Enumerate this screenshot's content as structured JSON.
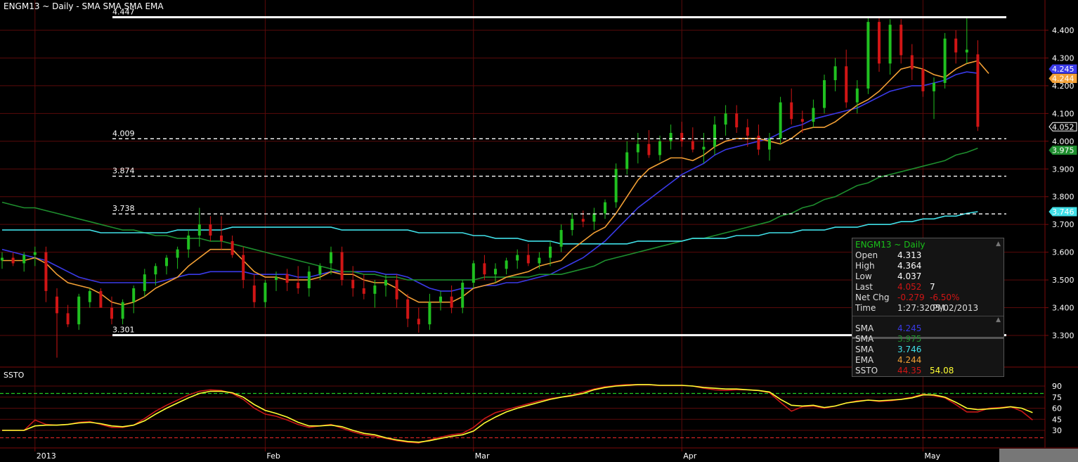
{
  "header": {
    "title": "ENGM13 ~ Daily  -  SMA SMA SMA EMA"
  },
  "colors": {
    "up": "#20c020",
    "down": "#d01515",
    "sma_blue": "#3a3ae8",
    "sma_green": "#1e8e2e",
    "sma_cyan": "#40e0e8",
    "ema_orange": "#f3a035",
    "ssto_k": "#ffff33",
    "ssto_d": "#c81818",
    "grid": "#5a0a0a",
    "axis": "#7a0a0a",
    "level": "#ffffff"
  },
  "levels": [
    {
      "value": 4.447,
      "label": "4.447",
      "style": "solid"
    },
    {
      "value": 4.009,
      "label": "4.009",
      "style": "dashed"
    },
    {
      "value": 3.874,
      "label": "3.874",
      "style": "dashed"
    },
    {
      "value": 3.738,
      "label": "3.738",
      "style": "dashed"
    },
    {
      "value": 3.301,
      "label": "3.301",
      "style": "solid"
    }
  ],
  "price_axis": {
    "ticks": [
      "4.400",
      "4.300",
      "4.200",
      "4.100",
      "4.000",
      "3.900",
      "3.800",
      "3.700",
      "3.600",
      "3.500",
      "3.400",
      "3.300"
    ],
    "tick_values": [
      4.4,
      4.3,
      4.2,
      4.1,
      4.0,
      3.9,
      3.8,
      3.7,
      3.6,
      3.5,
      3.4,
      3.3
    ],
    "ylim": [
      3.2,
      4.5
    ],
    "markers": [
      {
        "label": "4.245",
        "value": 4.245,
        "color": "#3a3ae8"
      },
      {
        "label": "4.244",
        "value": 4.244,
        "color": "#f3a035"
      },
      {
        "label": "4.052",
        "value": 4.052,
        "color": "#000000"
      },
      {
        "label": "3.975",
        "value": 3.975,
        "color": "#1e8e2e"
      },
      {
        "label": "3.746",
        "value": 3.746,
        "color": "#40e0e8"
      }
    ]
  },
  "ssto_panel": {
    "label": "SSTO",
    "ticks": [
      "90",
      "75",
      "60",
      "45",
      "30"
    ],
    "tick_values": [
      90,
      75,
      60,
      45,
      30
    ],
    "upper": 80,
    "lower": 20,
    "ylim": [
      15,
      95
    ]
  },
  "x_axis": {
    "labels": [
      {
        "text": "2013",
        "index": 3
      },
      {
        "text": "Feb",
        "index": 24
      },
      {
        "text": "Mar",
        "index": 43
      },
      {
        "text": "Apr",
        "index": 62
      },
      {
        "text": "May",
        "index": 84
      }
    ]
  },
  "info_box": {
    "title": "ENGM13 ~ Daily",
    "rows": [
      {
        "label": "Open",
        "value": "4.313",
        "color": "#ffffff"
      },
      {
        "label": "High",
        "value": "4.364",
        "color": "#ffffff"
      },
      {
        "label": "Low",
        "value": "4.037",
        "color": "#ffffff"
      },
      {
        "label": "Last",
        "value": "4.052",
        "color": "#d01515",
        "extra": "7",
        "extra_color": "#ffffff"
      },
      {
        "label": "Net Chg",
        "value": "-0.279",
        "color": "#d01515",
        "extra": "-6.50%",
        "extra_color": "#d01515"
      },
      {
        "label": "Time",
        "value": "1:27:32 PM",
        "color": "#dddddd",
        "extra": "05/02/2013",
        "extra_color": "#dddddd"
      }
    ],
    "studies": [
      {
        "label": "SMA",
        "value": "4.245",
        "color": "#3a3ae8"
      },
      {
        "label": "SMA",
        "value": "3.975",
        "color": "#1e8e2e"
      },
      {
        "label": "SMA",
        "value": "3.746",
        "color": "#40e0e8"
      },
      {
        "label": "EMA",
        "value": "4.244",
        "color": "#f3a035"
      },
      {
        "label": "SSTO",
        "value": "44.35",
        "color": "#d01515",
        "extra": "54.08",
        "extra_color": "#ffff33"
      }
    ]
  },
  "chart_data": {
    "type": "candlestick",
    "title": "ENGM13 ~ Daily",
    "candles": [
      [
        3.57,
        3.6,
        3.54,
        3.58
      ],
      [
        3.58,
        3.6,
        3.55,
        3.56
      ],
      [
        3.56,
        3.6,
        3.53,
        3.59
      ],
      [
        3.59,
        3.62,
        3.55,
        3.6
      ],
      [
        3.6,
        3.62,
        3.42,
        3.46
      ],
      [
        3.44,
        3.47,
        3.22,
        3.38
      ],
      [
        3.38,
        3.41,
        3.33,
        3.34
      ],
      [
        3.34,
        3.45,
        3.32,
        3.44
      ],
      [
        3.42,
        3.47,
        3.4,
        3.46
      ],
      [
        3.46,
        3.47,
        3.4,
        3.4
      ],
      [
        3.4,
        3.44,
        3.34,
        3.36
      ],
      [
        3.36,
        3.43,
        3.34,
        3.42
      ],
      [
        3.42,
        3.48,
        3.38,
        3.47
      ],
      [
        3.46,
        3.54,
        3.44,
        3.52
      ],
      [
        3.52,
        3.56,
        3.48,
        3.55
      ],
      [
        3.55,
        3.59,
        3.52,
        3.58
      ],
      [
        3.58,
        3.62,
        3.54,
        3.61
      ],
      [
        3.61,
        3.68,
        3.58,
        3.66
      ],
      [
        3.66,
        3.76,
        3.62,
        3.7
      ],
      [
        3.7,
        3.73,
        3.64,
        3.66
      ],
      [
        3.66,
        3.73,
        3.61,
        3.64
      ],
      [
        3.64,
        3.66,
        3.58,
        3.59
      ],
      [
        3.59,
        3.62,
        3.47,
        3.5
      ],
      [
        3.48,
        3.52,
        3.4,
        3.42
      ],
      [
        3.42,
        3.5,
        3.4,
        3.49
      ],
      [
        3.5,
        3.53,
        3.46,
        3.51
      ],
      [
        3.52,
        3.54,
        3.46,
        3.49
      ],
      [
        3.49,
        3.55,
        3.45,
        3.47
      ],
      [
        3.47,
        3.55,
        3.44,
        3.53
      ],
      [
        3.52,
        3.56,
        3.5,
        3.55
      ],
      [
        3.56,
        3.62,
        3.52,
        3.6
      ],
      [
        3.6,
        3.62,
        3.48,
        3.5
      ],
      [
        3.5,
        3.55,
        3.44,
        3.47
      ],
      [
        3.47,
        3.52,
        3.43,
        3.45
      ],
      [
        3.45,
        3.5,
        3.4,
        3.48
      ],
      [
        3.48,
        3.52,
        3.44,
        3.5
      ],
      [
        3.5,
        3.52,
        3.4,
        3.43
      ],
      [
        3.43,
        3.45,
        3.33,
        3.36
      ],
      [
        3.36,
        3.4,
        3.31,
        3.34
      ],
      [
        3.34,
        3.45,
        3.32,
        3.42
      ],
      [
        3.42,
        3.46,
        3.39,
        3.44
      ],
      [
        3.44,
        3.48,
        3.38,
        3.4
      ],
      [
        3.4,
        3.5,
        3.38,
        3.49
      ],
      [
        3.49,
        3.57,
        3.47,
        3.56
      ],
      [
        3.56,
        3.59,
        3.5,
        3.52
      ],
      [
        3.52,
        3.56,
        3.49,
        3.54
      ],
      [
        3.54,
        3.58,
        3.52,
        3.57
      ],
      [
        3.57,
        3.61,
        3.54,
        3.59
      ],
      [
        3.59,
        3.63,
        3.55,
        3.56
      ],
      [
        3.56,
        3.6,
        3.54,
        3.58
      ],
      [
        3.58,
        3.64,
        3.55,
        3.62
      ],
      [
        3.62,
        3.7,
        3.6,
        3.68
      ],
      [
        3.68,
        3.74,
        3.66,
        3.72
      ],
      [
        3.72,
        3.75,
        3.69,
        3.71
      ],
      [
        3.71,
        3.76,
        3.68,
        3.74
      ],
      [
        3.74,
        3.79,
        3.72,
        3.78
      ],
      [
        3.78,
        3.92,
        3.76,
        3.9
      ],
      [
        3.9,
        4.0,
        3.88,
        3.96
      ],
      [
        3.96,
        4.03,
        3.92,
        3.99
      ],
      [
        3.99,
        4.04,
        3.94,
        3.95
      ],
      [
        3.95,
        4.02,
        3.93,
        4.0
      ],
      [
        4.0,
        4.06,
        3.97,
        4.03
      ],
      [
        4.03,
        4.07,
        3.98,
        4.0
      ],
      [
        4.0,
        4.05,
        3.96,
        3.97
      ],
      [
        3.97,
        4.03,
        3.92,
        3.98
      ],
      [
        3.98,
        4.09,
        3.95,
        4.06
      ],
      [
        4.06,
        4.13,
        4.02,
        4.1
      ],
      [
        4.1,
        4.13,
        4.03,
        4.05
      ],
      [
        4.05,
        4.08,
        3.98,
        4.02
      ],
      [
        4.02,
        4.06,
        3.95,
        3.97
      ],
      [
        3.97,
        4.03,
        3.93,
        4.01
      ],
      [
        4.01,
        4.16,
        3.99,
        4.14
      ],
      [
        4.14,
        4.19,
        4.06,
        4.08
      ],
      [
        4.08,
        4.11,
        4.03,
        4.07
      ],
      [
        4.07,
        4.15,
        4.05,
        4.12
      ],
      [
        4.12,
        4.24,
        4.1,
        4.22
      ],
      [
        4.22,
        4.3,
        4.18,
        4.27
      ],
      [
        4.27,
        4.33,
        4.12,
        4.14
      ],
      [
        4.14,
        4.22,
        4.1,
        4.19
      ],
      [
        4.19,
        4.45,
        4.17,
        4.43
      ],
      [
        4.43,
        4.45,
        4.25,
        4.28
      ],
      [
        4.28,
        4.44,
        4.24,
        4.42
      ],
      [
        4.42,
        4.44,
        4.28,
        4.31
      ],
      [
        4.31,
        4.35,
        4.22,
        4.26
      ],
      [
        4.26,
        4.3,
        4.16,
        4.18
      ],
      [
        4.18,
        4.23,
        4.08,
        4.21
      ],
      [
        4.21,
        4.39,
        4.19,
        4.37
      ],
      [
        4.37,
        4.4,
        4.28,
        4.32
      ],
      [
        4.32,
        4.45,
        4.28,
        4.33
      ],
      [
        4.313,
        4.364,
        4.037,
        4.052
      ]
    ],
    "series": [
      {
        "name": "SMA",
        "color": "#3a3ae8",
        "values": [
          3.61,
          3.6,
          3.59,
          3.58,
          3.57,
          3.55,
          3.53,
          3.51,
          3.5,
          3.49,
          3.49,
          3.49,
          3.49,
          3.49,
          3.49,
          3.5,
          3.51,
          3.52,
          3.52,
          3.53,
          3.53,
          3.53,
          3.53,
          3.52,
          3.52,
          3.52,
          3.52,
          3.51,
          3.51,
          3.52,
          3.53,
          3.53,
          3.53,
          3.53,
          3.53,
          3.52,
          3.52,
          3.51,
          3.49,
          3.47,
          3.46,
          3.46,
          3.47,
          3.47,
          3.48,
          3.48,
          3.49,
          3.49,
          3.5,
          3.51,
          3.52,
          3.54,
          3.56,
          3.58,
          3.61,
          3.64,
          3.68,
          3.72,
          3.76,
          3.79,
          3.82,
          3.85,
          3.88,
          3.9,
          3.92,
          3.95,
          3.97,
          3.98,
          3.99,
          4.0,
          4.01,
          4.03,
          4.05,
          4.06,
          4.08,
          4.09,
          4.1,
          4.11,
          4.12,
          4.14,
          4.16,
          4.18,
          4.19,
          4.2,
          4.2,
          4.21,
          4.22,
          4.24,
          4.25,
          4.245
        ]
      },
      {
        "name": "SMA",
        "color": "#1e8e2e",
        "values": [
          3.78,
          3.77,
          3.76,
          3.76,
          3.75,
          3.74,
          3.73,
          3.72,
          3.71,
          3.7,
          3.69,
          3.68,
          3.68,
          3.67,
          3.66,
          3.66,
          3.65,
          3.65,
          3.65,
          3.64,
          3.64,
          3.63,
          3.62,
          3.61,
          3.6,
          3.59,
          3.58,
          3.57,
          3.56,
          3.55,
          3.54,
          3.53,
          3.53,
          3.52,
          3.52,
          3.51,
          3.51,
          3.5,
          3.5,
          3.5,
          3.5,
          3.5,
          3.5,
          3.5,
          3.51,
          3.51,
          3.51,
          3.51,
          3.51,
          3.52,
          3.52,
          3.52,
          3.53,
          3.54,
          3.55,
          3.57,
          3.58,
          3.59,
          3.6,
          3.61,
          3.62,
          3.63,
          3.64,
          3.65,
          3.65,
          3.66,
          3.67,
          3.68,
          3.69,
          3.7,
          3.71,
          3.73,
          3.74,
          3.76,
          3.77,
          3.79,
          3.8,
          3.82,
          3.84,
          3.85,
          3.87,
          3.88,
          3.89,
          3.9,
          3.91,
          3.92,
          3.93,
          3.95,
          3.96,
          3.975
        ]
      },
      {
        "name": "SMA",
        "color": "#40e0e8",
        "values": [
          3.68,
          3.68,
          3.68,
          3.68,
          3.68,
          3.68,
          3.68,
          3.68,
          3.68,
          3.67,
          3.67,
          3.67,
          3.67,
          3.67,
          3.67,
          3.67,
          3.68,
          3.68,
          3.68,
          3.68,
          3.68,
          3.69,
          3.69,
          3.69,
          3.69,
          3.69,
          3.69,
          3.69,
          3.69,
          3.69,
          3.69,
          3.68,
          3.68,
          3.68,
          3.68,
          3.68,
          3.68,
          3.68,
          3.67,
          3.67,
          3.67,
          3.67,
          3.67,
          3.66,
          3.66,
          3.65,
          3.65,
          3.65,
          3.64,
          3.64,
          3.64,
          3.63,
          3.63,
          3.63,
          3.63,
          3.63,
          3.63,
          3.63,
          3.64,
          3.64,
          3.64,
          3.64,
          3.64,
          3.65,
          3.65,
          3.65,
          3.65,
          3.66,
          3.66,
          3.66,
          3.67,
          3.67,
          3.67,
          3.68,
          3.68,
          3.68,
          3.69,
          3.69,
          3.69,
          3.7,
          3.7,
          3.7,
          3.71,
          3.71,
          3.72,
          3.72,
          3.73,
          3.73,
          3.74,
          3.746
        ]
      },
      {
        "name": "EMA",
        "color": "#f3a035",
        "values": [
          3.57,
          3.57,
          3.57,
          3.58,
          3.56,
          3.52,
          3.49,
          3.48,
          3.47,
          3.45,
          3.42,
          3.41,
          3.42,
          3.44,
          3.47,
          3.49,
          3.51,
          3.55,
          3.58,
          3.61,
          3.61,
          3.61,
          3.57,
          3.53,
          3.51,
          3.51,
          3.5,
          3.5,
          3.5,
          3.51,
          3.53,
          3.52,
          3.52,
          3.5,
          3.49,
          3.49,
          3.47,
          3.44,
          3.42,
          3.42,
          3.42,
          3.42,
          3.44,
          3.47,
          3.48,
          3.49,
          3.51,
          3.52,
          3.53,
          3.55,
          3.56,
          3.57,
          3.61,
          3.64,
          3.67,
          3.69,
          3.74,
          3.8,
          3.86,
          3.9,
          3.92,
          3.94,
          3.94,
          3.93,
          3.95,
          3.98,
          4.0,
          4.01,
          4.01,
          4.01,
          4.0,
          3.99,
          4.01,
          4.04,
          4.05,
          4.05,
          4.07,
          4.1,
          4.13,
          4.15,
          4.18,
          4.22,
          4.26,
          4.27,
          4.26,
          4.24,
          4.23,
          4.26,
          4.28,
          4.29,
          4.244
        ]
      }
    ],
    "ssto": {
      "k": [
        30,
        30,
        30,
        36,
        37,
        37,
        38,
        40,
        41,
        39,
        36,
        35,
        37,
        43,
        52,
        60,
        67,
        74,
        80,
        83,
        83,
        81,
        75,
        65,
        57,
        53,
        48,
        41,
        36,
        36,
        37,
        35,
        30,
        26,
        24,
        20,
        17,
        15,
        14,
        16,
        19,
        22,
        24,
        29,
        40,
        48,
        55,
        60,
        64,
        68,
        72,
        75,
        77,
        80,
        85,
        88,
        90,
        91,
        92,
        92,
        91,
        91,
        91,
        90,
        88,
        87,
        86,
        86,
        85,
        84,
        82,
        72,
        64,
        63,
        64,
        61,
        63,
        67,
        69,
        71,
        70,
        71,
        72,
        74,
        78,
        78,
        75,
        68,
        60,
        58,
        59,
        60,
        62,
        60,
        54
      ],
      "d": [
        30,
        30,
        30,
        44,
        38,
        37,
        38,
        41,
        42,
        38,
        34,
        34,
        37,
        46,
        56,
        64,
        71,
        78,
        83,
        85,
        84,
        80,
        72,
        60,
        52,
        49,
        44,
        38,
        34,
        36,
        38,
        33,
        28,
        24,
        22,
        19,
        16,
        14,
        13,
        17,
        21,
        24,
        26,
        34,
        46,
        54,
        58,
        62,
        66,
        70,
        73,
        75,
        78,
        82,
        86,
        89,
        91,
        92,
        92,
        92,
        91,
        91,
        91,
        90,
        87,
        85,
        84,
        85,
        85,
        84,
        81,
        68,
        56,
        62,
        63,
        60,
        63,
        67,
        70,
        71,
        69,
        70,
        72,
        75,
        79,
        77,
        74,
        65,
        55,
        55,
        60,
        61,
        62,
        56,
        44
      ]
    },
    "ylim": [
      3.2,
      4.5
    ]
  }
}
